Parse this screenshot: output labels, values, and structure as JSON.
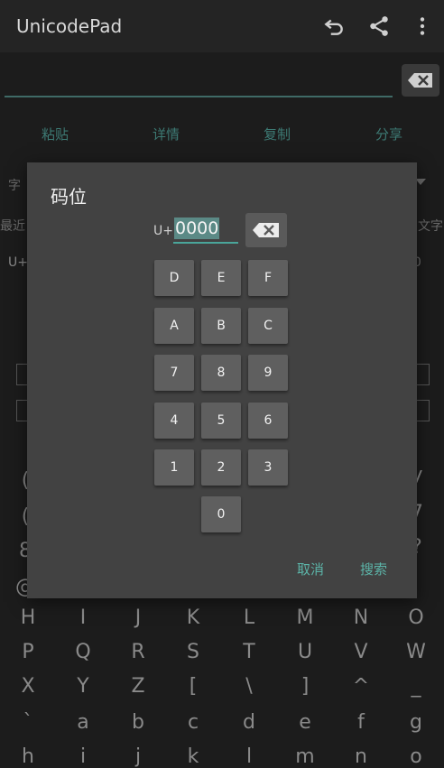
{
  "app": {
    "title": "UnicodePad"
  },
  "actions": [
    "粘贴",
    "详情",
    "复制",
    "分享"
  ],
  "background": {
    "left_labels": [
      "字",
      "最近",
      "U+"
    ],
    "right_labels": [
      "文字",
      "0"
    ],
    "keyboard_rows": [
      [
        "H",
        "I",
        "J",
        "K",
        "L",
        "M",
        "N",
        "O"
      ],
      [
        "P",
        "Q",
        "R",
        "S",
        "T",
        "U",
        "V",
        "W"
      ],
      [
        "X",
        "Y",
        "Z",
        "[",
        "\\",
        "]",
        "^",
        "_"
      ],
      [
        "`",
        "a",
        "b",
        "c",
        "d",
        "e",
        "f",
        "g"
      ],
      [
        "h",
        "i",
        "j",
        "k",
        "l",
        "m",
        "n",
        "o"
      ]
    ],
    "edge_left": [
      "(",
      "(",
      "8",
      "@"
    ],
    "edge_right": [
      "y",
      "7",
      "?",
      "O"
    ]
  },
  "dialog": {
    "title": "码位",
    "prefix": "U+",
    "code_value": "0000",
    "keys": [
      "D",
      "E",
      "F",
      "A",
      "B",
      "C",
      "7",
      "8",
      "9",
      "4",
      "5",
      "6",
      "1",
      "2",
      "3",
      "0"
    ],
    "cancel_label": "取消",
    "search_label": "搜索"
  }
}
